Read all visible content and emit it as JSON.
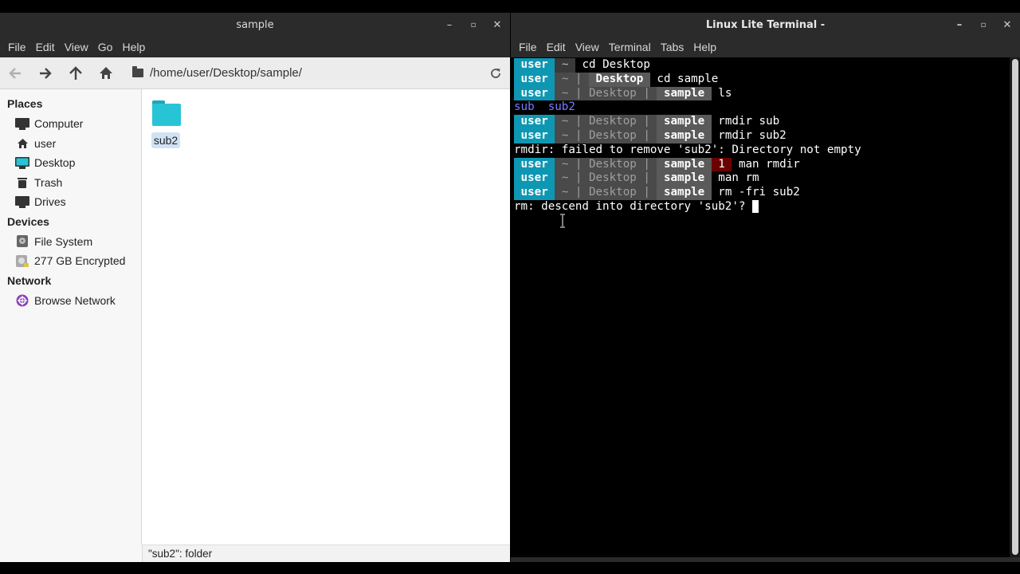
{
  "file_manager": {
    "title": "sample",
    "menu": [
      "File",
      "Edit",
      "View",
      "Go",
      "Help"
    ],
    "path": "/home/user/Desktop/sample/",
    "places_label": "Places",
    "places": [
      "Computer",
      "user",
      "Desktop",
      "Trash",
      "Drives"
    ],
    "devices_label": "Devices",
    "devices": [
      "File System",
      "277 GB Encrypted"
    ],
    "network_label": "Network",
    "network": [
      "Browse Network"
    ],
    "files": [
      {
        "name": "sub2",
        "icon": "folder-icon"
      }
    ],
    "status": "\"sub2\": folder"
  },
  "terminal": {
    "title": "Linux Lite Terminal -",
    "menu": [
      "File",
      "Edit",
      "View",
      "Terminal",
      "Tabs",
      "Help"
    ],
    "prompt": {
      "user": "user",
      "home": "~",
      "dir1": "Desktop",
      "dir2": "sample",
      "err_code": "1"
    },
    "lines": {
      "cmd1": "cd Desktop",
      "cmd2": "cd sample",
      "cmd3": "ls",
      "ls_out1": "sub",
      "ls_out2": "sub2",
      "cmd4": "rmdir sub",
      "cmd5": "rmdir sub2",
      "err1": "rmdir: failed to remove 'sub2': Directory not empty",
      "cmd6": "man rmdir",
      "cmd7": "man rm",
      "cmd8": "rm -fri sub2",
      "prompt_q": "rm: descend into directory 'sub2'? "
    }
  },
  "colors": {
    "prompt_user_bg": "#0e97b3",
    "folder": "#27c4d6",
    "error_bg": "#6b0000"
  }
}
